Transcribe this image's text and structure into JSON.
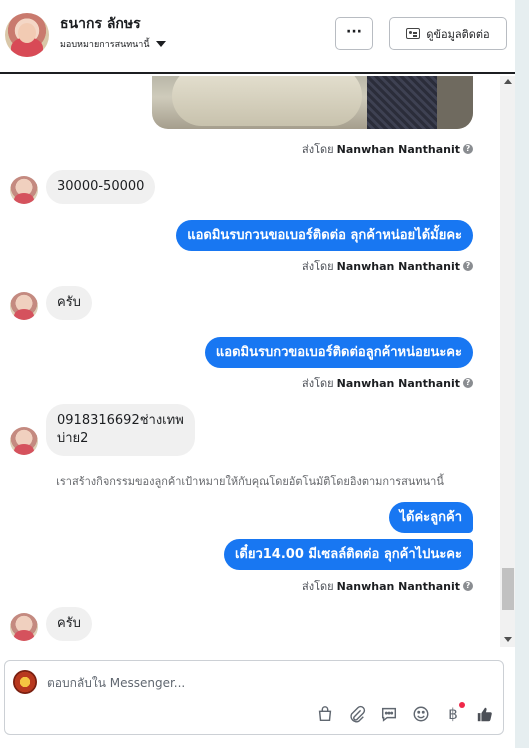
{
  "header": {
    "name": "ธนากร ลักษร",
    "assign_label": "มอบหมายการสนทนานี้",
    "more_label": "···",
    "contact_label": "ดูข้อมูลติดต่อ"
  },
  "messages": [
    {
      "type": "sent_by",
      "prefix": "ส่งโดย",
      "name": "Nanwhan Nanthanit"
    },
    {
      "type": "in",
      "text": "30000-50000"
    },
    {
      "type": "out",
      "text": "แอดมินรบกวนขอเบอร์ติดต่อ ลุกค้าหน่อยได้มั้ยคะ"
    },
    {
      "type": "sent_by",
      "prefix": "ส่งโดย",
      "name": "Nanwhan Nanthanit"
    },
    {
      "type": "in",
      "text": "ครับ"
    },
    {
      "type": "out",
      "text": "แอดมินรบกวขอเบอร์ติดต่อลูกค้าหน่อยนะคะ"
    },
    {
      "type": "sent_by",
      "prefix": "ส่งโดย",
      "name": "Nanwhan Nanthanit"
    },
    {
      "type": "in",
      "line1": "0918316692ช่างเทพ",
      "line2": "บ่าย2"
    },
    {
      "type": "system",
      "text": "เราสร้างกิจกรรมของลูกค้าเป้าหมายให้กับคุณโดยอัตโนมัติโดยอิงตามการสนทนานี้"
    },
    {
      "type": "out",
      "text": "ได้ค่ะลูกค้า"
    },
    {
      "type": "out",
      "text": "เดี๋ยว14.00 มีเซลล์ติดต่อ ลุกค้าไปนะคะ"
    },
    {
      "type": "sent_by",
      "prefix": "ส่งโดย",
      "name": "Nanwhan Nanthanit"
    },
    {
      "type": "in",
      "text": "ครับ"
    }
  ],
  "composer": {
    "placeholder": "ตอบกลับใน Messenger...",
    "tools": [
      "bag-icon",
      "paperclip-icon",
      "chat-bubble-icon",
      "emoji-icon",
      "baht-icon",
      "thumbs-up-icon"
    ]
  },
  "colors": {
    "accent": "#1877f2",
    "incoming_bubble": "#f0f0f0",
    "notification": "#f02849"
  }
}
